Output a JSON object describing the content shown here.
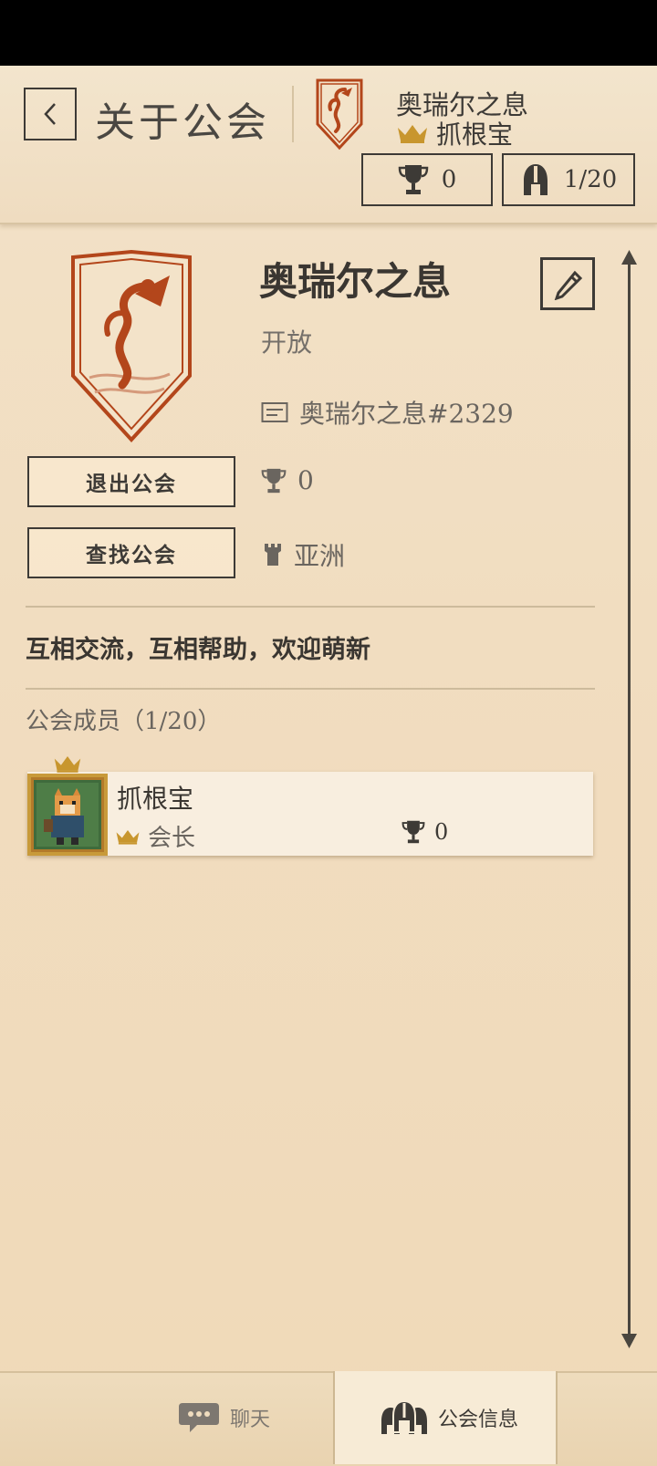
{
  "header": {
    "title": "关于公会",
    "guild_name": "奥瑞尔之息",
    "leader_name": "抓根宝",
    "trophies": "0",
    "members_count": "1/20"
  },
  "guild": {
    "name": "奥瑞尔之息",
    "status": "开放",
    "tag": "奥瑞尔之息#2329",
    "trophies": "0",
    "region": "亚洲",
    "description": "互相交流，互相帮助，欢迎萌新"
  },
  "buttons": {
    "leave": "退出公会",
    "find": "查找公会"
  },
  "members": {
    "title": "公会成员（1/20）",
    "list": [
      {
        "name": "抓根宝",
        "role": "会长",
        "trophies": "0"
      }
    ]
  },
  "tabs": {
    "chat": "聊天",
    "guild_info": "公会信息"
  },
  "colors": {
    "accent_red": "#b3461b",
    "crown_gold": "#c8962e",
    "ink": "#3d3a36",
    "paper": "#f1ddc0"
  }
}
